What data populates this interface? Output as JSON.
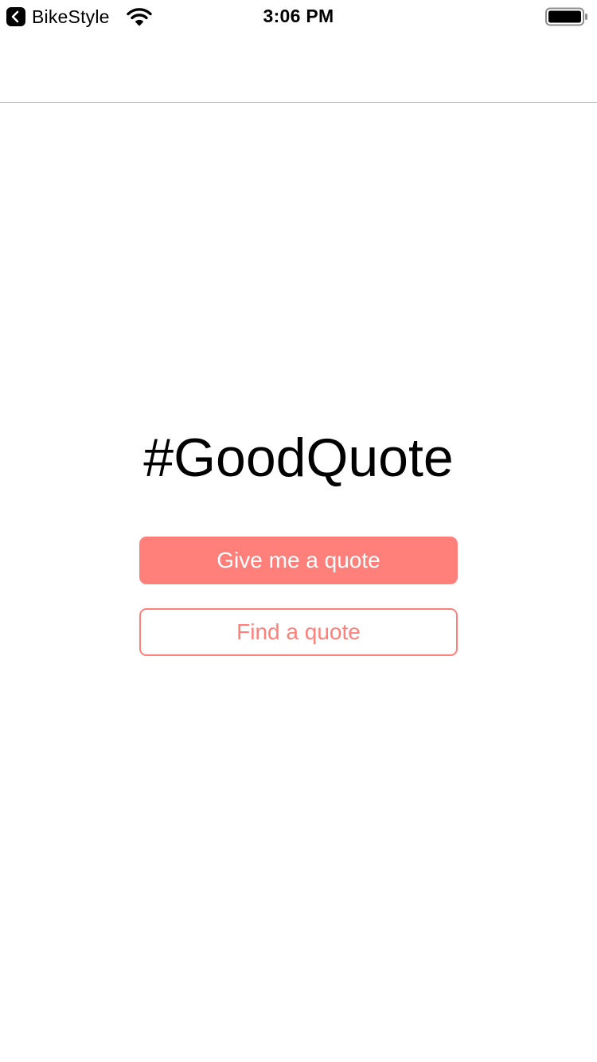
{
  "status_bar": {
    "back_app_label": "BikeStyle",
    "time": "3:06 PM",
    "icons": [
      "back-chevron-icon",
      "wifi-icon",
      "battery-icon"
    ]
  },
  "main": {
    "title": "#GoodQuote",
    "primary_button_label": "Give me a quote",
    "secondary_button_label": "Find a quote"
  },
  "colors": {
    "accent": "#ff7f7a",
    "background": "#ffffff",
    "text": "#000000",
    "divider": "#b2b2b2"
  }
}
